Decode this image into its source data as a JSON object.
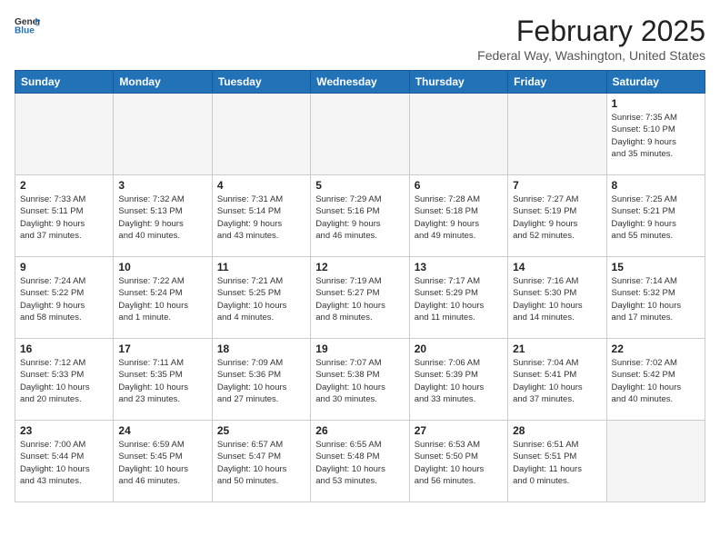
{
  "header": {
    "logo_general": "General",
    "logo_blue": "Blue",
    "title": "February 2025",
    "subtitle": "Federal Way, Washington, United States"
  },
  "days_of_week": [
    "Sunday",
    "Monday",
    "Tuesday",
    "Wednesday",
    "Thursday",
    "Friday",
    "Saturday"
  ],
  "weeks": [
    [
      {
        "day": "",
        "info": ""
      },
      {
        "day": "",
        "info": ""
      },
      {
        "day": "",
        "info": ""
      },
      {
        "day": "",
        "info": ""
      },
      {
        "day": "",
        "info": ""
      },
      {
        "day": "",
        "info": ""
      },
      {
        "day": "1",
        "info": "Sunrise: 7:35 AM\nSunset: 5:10 PM\nDaylight: 9 hours\nand 35 minutes."
      }
    ],
    [
      {
        "day": "2",
        "info": "Sunrise: 7:33 AM\nSunset: 5:11 PM\nDaylight: 9 hours\nand 37 minutes."
      },
      {
        "day": "3",
        "info": "Sunrise: 7:32 AM\nSunset: 5:13 PM\nDaylight: 9 hours\nand 40 minutes."
      },
      {
        "day": "4",
        "info": "Sunrise: 7:31 AM\nSunset: 5:14 PM\nDaylight: 9 hours\nand 43 minutes."
      },
      {
        "day": "5",
        "info": "Sunrise: 7:29 AM\nSunset: 5:16 PM\nDaylight: 9 hours\nand 46 minutes."
      },
      {
        "day": "6",
        "info": "Sunrise: 7:28 AM\nSunset: 5:18 PM\nDaylight: 9 hours\nand 49 minutes."
      },
      {
        "day": "7",
        "info": "Sunrise: 7:27 AM\nSunset: 5:19 PM\nDaylight: 9 hours\nand 52 minutes."
      },
      {
        "day": "8",
        "info": "Sunrise: 7:25 AM\nSunset: 5:21 PM\nDaylight: 9 hours\nand 55 minutes."
      }
    ],
    [
      {
        "day": "9",
        "info": "Sunrise: 7:24 AM\nSunset: 5:22 PM\nDaylight: 9 hours\nand 58 minutes."
      },
      {
        "day": "10",
        "info": "Sunrise: 7:22 AM\nSunset: 5:24 PM\nDaylight: 10 hours\nand 1 minute."
      },
      {
        "day": "11",
        "info": "Sunrise: 7:21 AM\nSunset: 5:25 PM\nDaylight: 10 hours\nand 4 minutes."
      },
      {
        "day": "12",
        "info": "Sunrise: 7:19 AM\nSunset: 5:27 PM\nDaylight: 10 hours\nand 8 minutes."
      },
      {
        "day": "13",
        "info": "Sunrise: 7:17 AM\nSunset: 5:29 PM\nDaylight: 10 hours\nand 11 minutes."
      },
      {
        "day": "14",
        "info": "Sunrise: 7:16 AM\nSunset: 5:30 PM\nDaylight: 10 hours\nand 14 minutes."
      },
      {
        "day": "15",
        "info": "Sunrise: 7:14 AM\nSunset: 5:32 PM\nDaylight: 10 hours\nand 17 minutes."
      }
    ],
    [
      {
        "day": "16",
        "info": "Sunrise: 7:12 AM\nSunset: 5:33 PM\nDaylight: 10 hours\nand 20 minutes."
      },
      {
        "day": "17",
        "info": "Sunrise: 7:11 AM\nSunset: 5:35 PM\nDaylight: 10 hours\nand 23 minutes."
      },
      {
        "day": "18",
        "info": "Sunrise: 7:09 AM\nSunset: 5:36 PM\nDaylight: 10 hours\nand 27 minutes."
      },
      {
        "day": "19",
        "info": "Sunrise: 7:07 AM\nSunset: 5:38 PM\nDaylight: 10 hours\nand 30 minutes."
      },
      {
        "day": "20",
        "info": "Sunrise: 7:06 AM\nSunset: 5:39 PM\nDaylight: 10 hours\nand 33 minutes."
      },
      {
        "day": "21",
        "info": "Sunrise: 7:04 AM\nSunset: 5:41 PM\nDaylight: 10 hours\nand 37 minutes."
      },
      {
        "day": "22",
        "info": "Sunrise: 7:02 AM\nSunset: 5:42 PM\nDaylight: 10 hours\nand 40 minutes."
      }
    ],
    [
      {
        "day": "23",
        "info": "Sunrise: 7:00 AM\nSunset: 5:44 PM\nDaylight: 10 hours\nand 43 minutes."
      },
      {
        "day": "24",
        "info": "Sunrise: 6:59 AM\nSunset: 5:45 PM\nDaylight: 10 hours\nand 46 minutes."
      },
      {
        "day": "25",
        "info": "Sunrise: 6:57 AM\nSunset: 5:47 PM\nDaylight: 10 hours\nand 50 minutes."
      },
      {
        "day": "26",
        "info": "Sunrise: 6:55 AM\nSunset: 5:48 PM\nDaylight: 10 hours\nand 53 minutes."
      },
      {
        "day": "27",
        "info": "Sunrise: 6:53 AM\nSunset: 5:50 PM\nDaylight: 10 hours\nand 56 minutes."
      },
      {
        "day": "28",
        "info": "Sunrise: 6:51 AM\nSunset: 5:51 PM\nDaylight: 11 hours\nand 0 minutes."
      },
      {
        "day": "",
        "info": ""
      }
    ]
  ]
}
